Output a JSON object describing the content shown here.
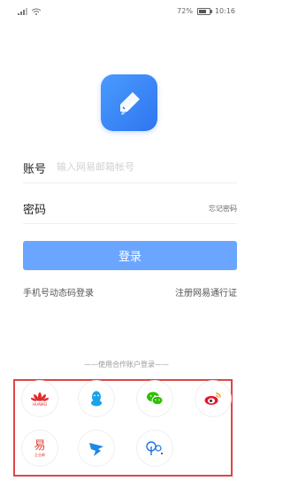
{
  "status_bar": {
    "battery": "72%",
    "time": "10:16"
  },
  "login": {
    "account_label": "账号",
    "account_placeholder": "输入网易邮箱帐号",
    "password_label": "密码",
    "forgot_password": "忘记密码",
    "login_button": "登录",
    "sms_login": "手机号动态码登录",
    "register": "注册网易通行证"
  },
  "partner": {
    "title": "——使用合作账户登录——",
    "items": [
      {
        "name": "huawei",
        "label": "HUAWEI"
      },
      {
        "name": "qq",
        "label": ""
      },
      {
        "name": "wechat",
        "label": ""
      },
      {
        "name": "weibo",
        "label": ""
      },
      {
        "name": "yixin",
        "label": "易",
        "sub": "企业邮"
      },
      {
        "name": "dingtalk",
        "label": ""
      },
      {
        "name": "popo",
        "label": ""
      }
    ]
  },
  "colors": {
    "primary": "#6aa6ff",
    "highlight_border": "#e04545"
  }
}
